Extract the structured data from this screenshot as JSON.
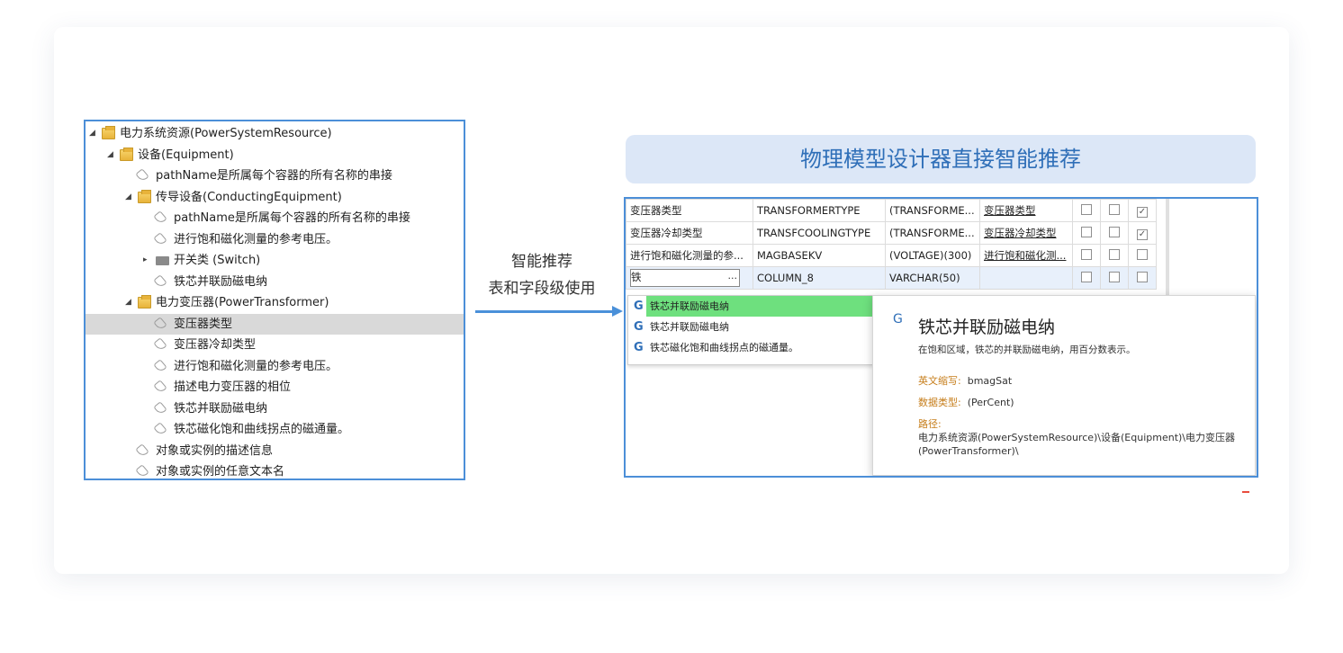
{
  "tree": {
    "rows": [
      {
        "label": "电力系统资源(PowerSystemResource)",
        "level": 0,
        "icon": "folder-open-icon",
        "arrow": "◢"
      },
      {
        "label": "设备(Equipment)",
        "level": 1,
        "icon": "folder-open-icon",
        "arrow": "◢"
      },
      {
        "label": "pathName是所属每个容器的所有名称的串接",
        "level": 2,
        "icon": "tag-icon",
        "arrow": ""
      },
      {
        "label": "传导设备(ConductingEquipment)",
        "level": 2,
        "icon": "folder-open-icon",
        "arrow": "◢"
      },
      {
        "label": "pathName是所属每个容器的所有名称的串接",
        "level": 3,
        "icon": "tag-icon",
        "arrow": ""
      },
      {
        "label": "进行饱和磁化测量的参考电压。",
        "level": 3,
        "icon": "tag-icon",
        "arrow": ""
      },
      {
        "label": "开关类 (Switch)",
        "level": 3,
        "icon": "folder-closed-icon",
        "arrow": "▸"
      },
      {
        "label": "铁芯并联励磁电纳",
        "level": 3,
        "icon": "tag-icon",
        "arrow": ""
      },
      {
        "label": "电力变压器(PowerTransformer)",
        "level": 2,
        "icon": "folder-open-icon",
        "arrow": "◢"
      },
      {
        "label": "变压器类型",
        "level": 3,
        "icon": "tag-icon",
        "arrow": "",
        "selected": true
      },
      {
        "label": "变压器冷却类型",
        "level": 3,
        "icon": "tag-icon",
        "arrow": ""
      },
      {
        "label": "进行饱和磁化测量的参考电压。",
        "level": 3,
        "icon": "tag-icon",
        "arrow": ""
      },
      {
        "label": "描述电力变压器的相位",
        "level": 3,
        "icon": "tag-icon",
        "arrow": ""
      },
      {
        "label": "铁芯并联励磁电纳",
        "level": 3,
        "icon": "tag-icon",
        "arrow": ""
      },
      {
        "label": "铁芯磁化饱和曲线拐点的磁通量。",
        "level": 3,
        "icon": "tag-icon",
        "arrow": ""
      },
      {
        "label": "对象或实例的描述信息",
        "level": 2,
        "icon": "tag-icon",
        "arrow": ""
      },
      {
        "label": "对象或实例的任意文本名",
        "level": 2,
        "icon": "tag-icon",
        "arrow": ""
      }
    ]
  },
  "middle": {
    "line1": "智能推荐",
    "line2": "表和字段级使用"
  },
  "banner": {
    "title": "物理模型设计器直接智能推荐"
  },
  "grid": {
    "rows": [
      {
        "c1": "变压器类型",
        "c2": "TRANSFORMERTYPE",
        "c3": "(TRANSFORME...",
        "c4": "变压器类型",
        "checks": [
          false,
          false,
          true
        ]
      },
      {
        "c1": "变压器冷却类型",
        "c2": "TRANSFCOOLINGTYPE",
        "c3": "(TRANSFORME...",
        "c4": "变压器冷却类型",
        "checks": [
          false,
          false,
          true
        ]
      },
      {
        "c1": "进行饱和磁化测量的参...",
        "c2": "MAGBASEKV",
        "c3": "(VOLTAGE)(300)",
        "c4": "进行饱和磁化测...",
        "checks": [
          false,
          false,
          false
        ]
      }
    ],
    "edit_row": {
      "input_value": "铁",
      "ellipsis": "...",
      "c2": "COLUMN_8",
      "c3": "VARCHAR(50)",
      "c4": "",
      "checks": [
        false,
        false,
        false
      ]
    },
    "check_mark": "✓",
    "suggestions": [
      {
        "label": "铁芯并联励磁电纳",
        "icon": "G",
        "highlighted": true
      },
      {
        "label": "铁芯并联励磁电纳",
        "icon": "G",
        "highlighted": false
      },
      {
        "label": "铁芯磁化饱和曲线拐点的磁通量。",
        "icon": "G",
        "highlighted": false
      }
    ],
    "tooltip": {
      "icon": "G",
      "title": "铁芯并联励磁电纳",
      "description": "在饱和区域，铁芯的并联励磁电纳，用百分数表示。",
      "abbr_key": "英文缩写:",
      "abbr_value": "bmagSat",
      "type_key": "数据类型:",
      "type_value": "(PerCent)",
      "path_key": "路径:",
      "path_value": "电力系统资源(PowerSystemResource)\\设备(Equipment)\\电力变压器(PowerTransformer)\\"
    }
  },
  "colors": {
    "accent_blue": "#4c8fd8",
    "banner_bg": "#dce7f7",
    "banner_text": "#2f6fb8",
    "highlight_green": "#6ee07e",
    "key_orange": "#c67d1a"
  }
}
